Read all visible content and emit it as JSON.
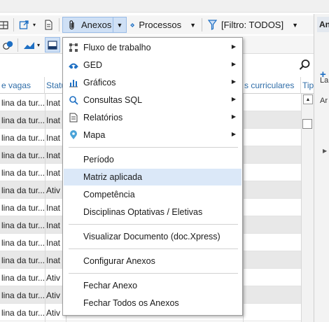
{
  "toolbar": {
    "anexos_label": "Anexos",
    "processos_label": "Processos",
    "filter_label": "[Filtro: TODOS]"
  },
  "right_panel": {
    "tab_label": "An",
    "item1": "La",
    "item2": "Ar"
  },
  "grid": {
    "columns": [
      "e vagas",
      "Statu",
      "s curriculares",
      "Tipo"
    ],
    "rows": [
      {
        "col1": "lina da tur...",
        "col2": "Inat"
      },
      {
        "col1": "lina da tur...",
        "col2": "Inat"
      },
      {
        "col1": "lina da tur...",
        "col2": "Inat"
      },
      {
        "col1": "lina da tur...",
        "col2": "Inat"
      },
      {
        "col1": "lina da tur...",
        "col2": "Inat"
      },
      {
        "col1": "lina da tur...",
        "col2": "Ativ"
      },
      {
        "col1": "lina da tur...",
        "col2": "Inat"
      },
      {
        "col1": "lina da tur...",
        "col2": "Inat"
      },
      {
        "col1": "lina da tur...",
        "col2": "Inat"
      },
      {
        "col1": "lina da tur...",
        "col2": "Inat"
      },
      {
        "col1": "lina da tur...",
        "col2": "Ativ"
      },
      {
        "col1": "lina da tur...",
        "col2": "Ativ"
      },
      {
        "col1": "lina da tur...",
        "col2": "Ativ"
      }
    ]
  },
  "menu": {
    "submenus": [
      {
        "label": "Fluxo de trabalho",
        "icon": "workflow-icon"
      },
      {
        "label": "GED",
        "icon": "ged-icon"
      },
      {
        "label": "Gráficos",
        "icon": "chart-icon"
      },
      {
        "label": "Consultas SQL",
        "icon": "search-icon"
      },
      {
        "label": "Relatórios",
        "icon": "report-icon"
      },
      {
        "label": "Mapa",
        "icon": "map-pin-icon"
      }
    ],
    "group2": [
      "Período",
      "Matriz aplicada",
      "Competência",
      "Disciplinas Optativas / Eletivas"
    ],
    "group3": [
      "Visualizar Documento (doc.Xpress)"
    ],
    "group4": [
      "Configurar Anexos"
    ],
    "group5": [
      "Fechar Anexo",
      "Fechar Todos os Anexos"
    ],
    "highlighted": "Matriz aplicada"
  },
  "colors": {
    "accent": "#1e6fc3",
    "header_text": "#2f6da8",
    "highlight": "#dbe8f8"
  }
}
